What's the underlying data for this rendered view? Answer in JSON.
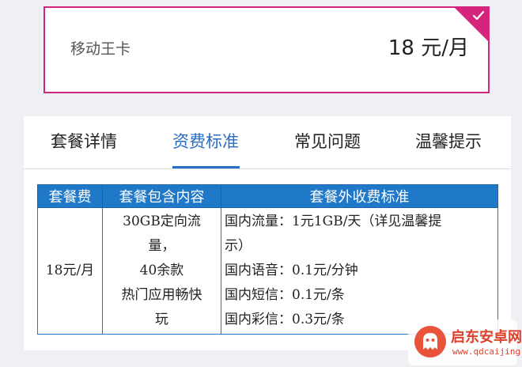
{
  "plan_card": {
    "name": "移动王卡",
    "price": "18 元/月",
    "selected_color": "#d4247c"
  },
  "tabs": [
    {
      "label": "套餐详情",
      "active": false
    },
    {
      "label": "资费标准",
      "active": true
    },
    {
      "label": "常见问题",
      "active": false
    },
    {
      "label": "温馨提示",
      "active": false
    }
  ],
  "accent_color": "#2b6cc4",
  "fee_table": {
    "headers": [
      "套餐费",
      "套餐包含内容",
      "套餐外收费标准"
    ],
    "row": {
      "price": "18元/月",
      "content_lines": [
        "30GB定向流",
        "量，",
        "40余款",
        "热门应用畅快",
        "玩"
      ],
      "extra_lines": [
        "国内流量：1元1GB/天（详见温馨提",
        "示）",
        "国内语音：0.1元/分钟",
        "国内短信：0.1元/条",
        "国内彩信：0.3元/条"
      ]
    }
  },
  "watermark": {
    "title": "启东安卓网",
    "url": "www.qdcaijing.com",
    "icon": "ghost-logo-icon"
  }
}
